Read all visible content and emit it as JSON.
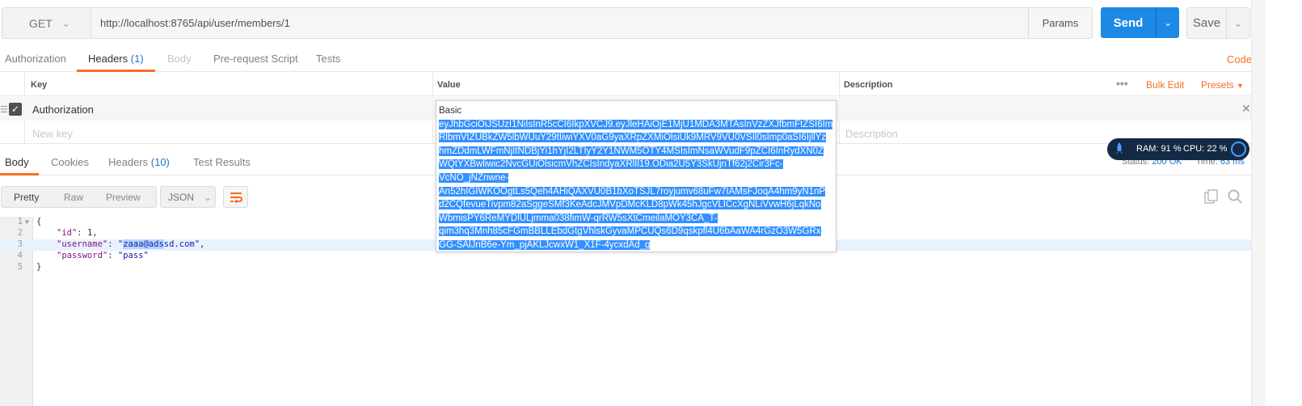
{
  "request": {
    "method": "GET",
    "url": "http://localhost:8765/api/user/members/1",
    "params_label": "Params",
    "send_label": "Send",
    "save_label": "Save"
  },
  "request_tabs": {
    "authorization": "Authorization",
    "headers": "Headers",
    "headers_count": "(1)",
    "body": "Body",
    "prerequest": "Pre-request Script",
    "tests": "Tests",
    "code": "Code"
  },
  "headers_table": {
    "col_key": "Key",
    "col_value": "Value",
    "col_description": "Description",
    "bulk_edit": "Bulk Edit",
    "presets": "Presets",
    "rows": [
      {
        "key": "Authorization",
        "value_prefix": "Basic",
        "description": ""
      }
    ],
    "new_key_placeholder": "New key",
    "description_placeholder": "Description"
  },
  "value_popup": {
    "prefix": "Basic",
    "lines": [
      "eyJhbGciOiJSUzI1NiIsInR5cCI6IkpXVCJ9.eyJleHAiOjE1MjU1MDA3MTAsInVzZXJfbmFtZSI6Im",
      "RlbmVtZUBkZW5lbWUuY29tIiwiYXV0aG9yaXRpZXMiOlsiUk9MRV9VU0VSIl0sImp0aSI6IjllYz",
      "hmZDdmLWFmNjItNDBjYi1hYjI2LTIyY2Y1NWM5OTY4MSIsImNsaWVudF9pZCI6InRydXN0Z",
      "WQtYXBwliwic2NvcGUiOlsicmVhZCIsIndyaXRlIl19.ODia2U5Y3SkUjnTf62j2Cir3Fc-",
      "VcNO_jNZnwne-",
      "An52hIGIWKOOgtLs5Qeh4AHiQAXVU0B1bXoTSJL7royjumv68uFw7IAMsFJoqA4hm9yN1nP",
      "d2CQfevueTivpm82aSggeSMf3KeAdcJMVpDMcKLD8pWk45hJgcVLICcXgNLiVvwH6jLqkNo",
      "WbmisPY6ReMYDlULjmma038fimW-qrRW5sXtCmeilaMOY3CA_T-",
      "qim3hq3Mnh85cFGmBBLLEbdGtgVhlskGyvaMPCUQs6D9qskpfl4U6bAaWA4rGzO3W5GRx",
      "GG-SAlJnB6e-Ym_pjAKLJcwxW1_X1F-4ycxdAd_g"
    ]
  },
  "response_tabs": {
    "body": "Body",
    "cookies": "Cookies",
    "headers": "Headers",
    "headers_count": "(10)",
    "test_results": "Test Results",
    "status_label": "Status:",
    "status_value": "200 OK",
    "time_label": "Time:",
    "time_value": "63 ms"
  },
  "body_toolbar": {
    "pretty": "Pretty",
    "raw": "Raw",
    "preview": "Preview",
    "format": "JSON"
  },
  "monitor": {
    "ram": "RAM: 91 %",
    "cpu": "CPU: 22 %"
  },
  "code_lines": [
    {
      "num": "1",
      "text": "{"
    },
    {
      "num": "2",
      "key": "\"id\"",
      "sep": ": ",
      "val": "1",
      "end": ","
    },
    {
      "num": "3",
      "key": "\"username\"",
      "sep": ": ",
      "val_pre": "\"",
      "val_sel": "zaaa@ads",
      "val_post": "sd.com\"",
      "end": ","
    },
    {
      "num": "4",
      "key": "\"password\"",
      "sep": ": ",
      "val": "\"pass\"",
      "end": ""
    },
    {
      "num": "5",
      "text": "}"
    }
  ],
  "colors": {
    "accent_orange": "#f47023",
    "send_blue": "#1e88e5",
    "link_blue": "#2076c4",
    "selection_blue": "#3390ff"
  }
}
